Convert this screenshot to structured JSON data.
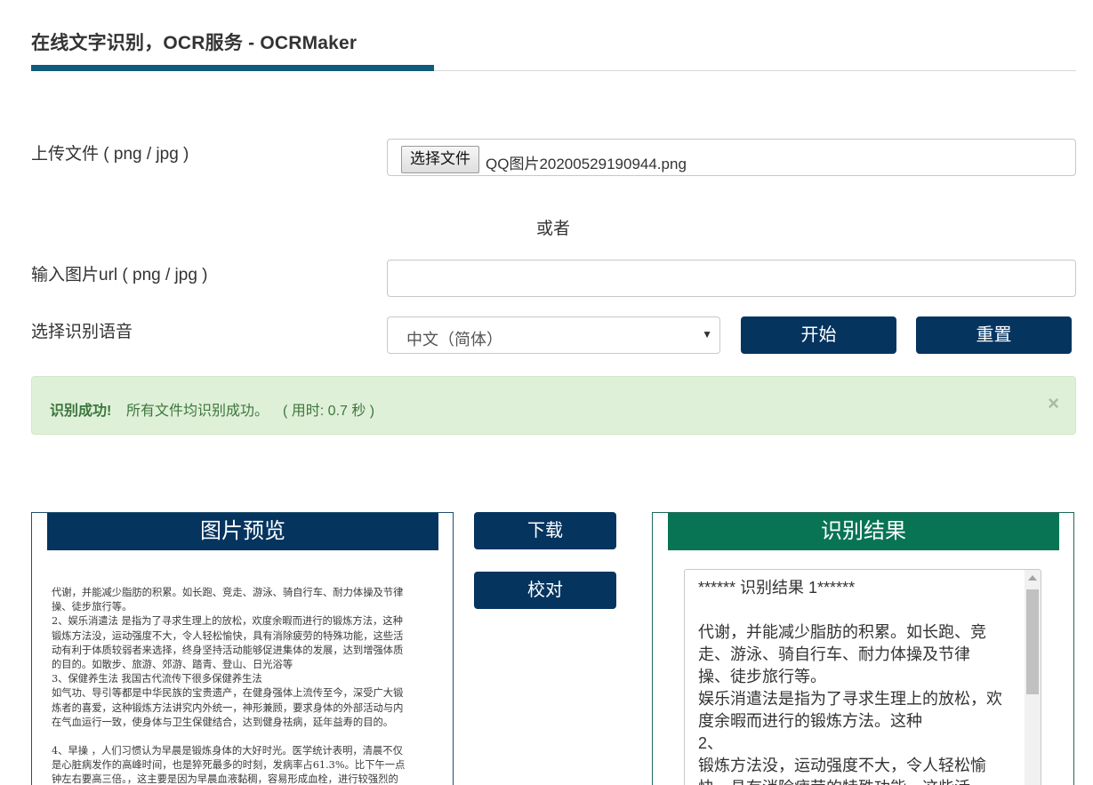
{
  "header": {
    "title": "在线文字识别，OCR服务 - OCRMaker"
  },
  "upload": {
    "label": "上传文件 ( png / jpg )",
    "choose_button": "选择文件",
    "file_name": "QQ图片20200529190944.png"
  },
  "or_text": "或者",
  "url": {
    "label": "输入图片url ( png / jpg )",
    "value": "",
    "placeholder": ""
  },
  "language": {
    "label": "选择识别语音",
    "selected": "中文（简体）"
  },
  "actions": {
    "start": "开始",
    "reset": "重置",
    "download": "下载",
    "proofread": "校对"
  },
  "alert": {
    "strong": "识别成功!",
    "message": "所有文件均识别成功。",
    "time": "( 用时: 0.7 秒 )",
    "close": "×"
  },
  "preview": {
    "title": "图片预览",
    "lines": [
      "代谢，并能减少脂肪的积累。如长跑、竞走、游泳、骑自行车、耐力体操及节律",
      "操、徒步旅行等。",
      "2、娱乐消遣法  是指为了寻求生理上的放松，欢度余暇而进行的锻炼方法，这种",
      "锻炼方法没，运动强度不大，令人轻松愉快，具有消除疲劳的特殊功能，这些活",
      "动有利于体质较弱者来选择，终身坚持活动能够促进集体的发展，达到增强体质",
      "的目的。如散步、旅游、郊游、踏青、登山、日光浴等",
      "3、保健养生法  我国古代流传下很多保健养生法",
      "如气功、导引等都是中华民族的宝贵遗产，在健身强体上流传至今，深受广大锻",
      "炼者的喜爱，这种锻炼方法讲究内外统一，神形兼顾，要求身体的外部活动与内",
      "在气血运行一致，使身体与卫生保健结合，达到健身祛病，延年益寿的目的。",
      "",
      "4、早操  ，人们习惯认为早晨是锻炼身体的大好时光。医学统计表明，清晨不仅",
      "是心脏病发作的高峰时间，也是猝死最多的时刻，发病率占61.3%。比下午一点",
      "钟左右要高三倍。，这主要是因为早晨血液黏稠，容易形成血栓，进行较强烈的"
    ]
  },
  "result": {
    "title": "识别结果",
    "text": "****** 识别结果 1******\n\n代谢，并能减少脂肪的积累。如长跑、竞\n走、游泳、骑自行车、耐力体操及节律\n操、徒步旅行等。\n娱乐消遣法是指为了寻求生理上的放松，欢\n度余暇而进行的锻炼方法。这种\n2、\n锻炼方法没，运动强度不大，令人轻松愉\n快，具有消除疲劳的特殊功能，这些活"
  }
}
